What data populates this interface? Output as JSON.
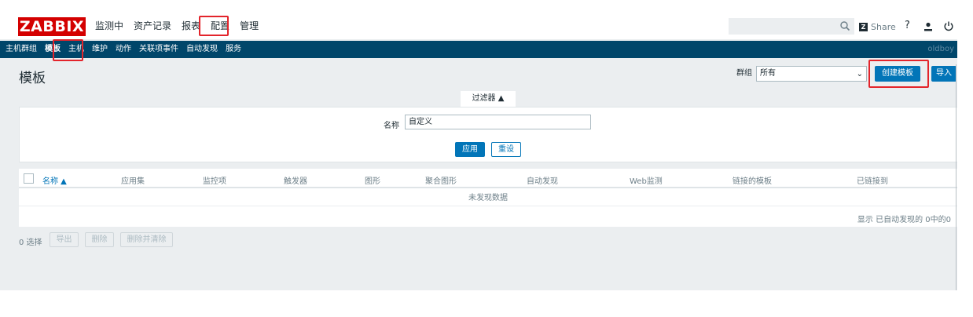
{
  "header": {
    "logo": "ZABBIX",
    "menu": [
      "监测中",
      "资产记录",
      "报表",
      "配置",
      "管理"
    ],
    "active_menu": "配置",
    "search": {
      "value": "",
      "placeholder": ""
    },
    "share_label": "Share",
    "help_label": "?"
  },
  "subnav": {
    "items": [
      "主机群组",
      "模板",
      "主机",
      "维护",
      "动作",
      "关联项事件",
      "自动发现",
      "服务"
    ],
    "selected": "模板",
    "server_name": "oldboy"
  },
  "page": {
    "title": "模板",
    "group_label": "群组",
    "group_value": "所有",
    "create_button": "创建模板",
    "import_button": "导入"
  },
  "filter": {
    "tab_label": "过滤器 ▲",
    "name_label": "名称",
    "name_value": "自定义",
    "apply_button": "应用",
    "reset_button": "重设"
  },
  "table": {
    "columns": [
      "名称 ▲",
      "应用集",
      "监控项",
      "触发器",
      "图形",
      "聚合图形",
      "自动发现",
      "Web监测",
      "链接的模板",
      "已链接到"
    ],
    "empty_text": "未发现数据",
    "paging_text": "显示 已自动发现的 0中的0"
  },
  "footer": {
    "selected_count": "0 选择",
    "export_button": "导出",
    "delete_button": "删除",
    "delete_clear_button": "删除并清除"
  },
  "colors": {
    "brand_red": "#d40000",
    "nav_blue": "#00466a",
    "primary": "#0275b8",
    "highlight_red": "#e3242b"
  }
}
